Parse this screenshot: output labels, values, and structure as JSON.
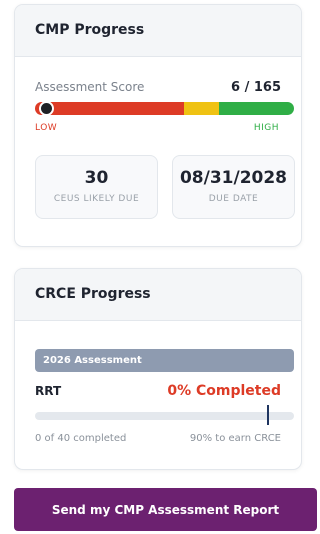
{
  "colors": {
    "low": "#dd3b26",
    "medium": "#efc213",
    "high": "#2fae46",
    "button": "#6c2170",
    "assessment_badge": "#8e9bb0"
  },
  "cmp": {
    "title": "CMP Progress",
    "score_label": "Assessment Score",
    "score_value": "6 / 165",
    "score_fraction": 0.036,
    "low_label": "LOW",
    "high_label": "HIGH",
    "ceus_value": "30",
    "ceus_label": "CEUS LIKELY DUE",
    "due_date_value": "08/31/2028",
    "due_date_label": "DUE DATE"
  },
  "crce": {
    "title": "CRCE Progress",
    "assessment_label": "2026 Assessment",
    "credential": "RRT",
    "completed_label": "0% Completed",
    "completed_fraction": 0,
    "threshold_fraction": 0.9,
    "completed_count_label": "0 of 40 completed",
    "threshold_label": "90% to earn CRCE"
  },
  "actions": {
    "send_report_label": "Send my CMP Assessment Report"
  }
}
